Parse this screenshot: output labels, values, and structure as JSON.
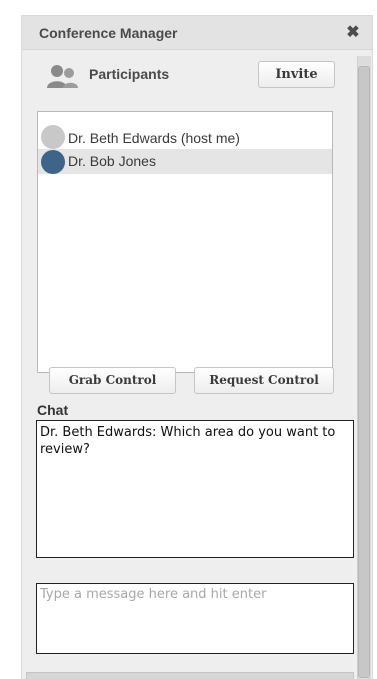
{
  "panel": {
    "title": "Conference Manager",
    "close_icon": "close-icon"
  },
  "participants": {
    "label": "Participants",
    "icon": "people-icon",
    "invite_label": "Invite",
    "list": [
      {
        "name": "Dr. Beth Edwards (host me)",
        "status_color": "#c8c8c8",
        "selected": false
      },
      {
        "name": "Dr. Bob Jones",
        "status_color": "#3d6489",
        "selected": true
      }
    ]
  },
  "controls": {
    "grab_label": "Grab Control",
    "request_label": "Request Control"
  },
  "chat": {
    "label": "Chat",
    "messages": "Dr. Beth Edwards: Which area do you want to review?",
    "input_placeholder": "Type a message here and hit enter",
    "input_value": ""
  }
}
